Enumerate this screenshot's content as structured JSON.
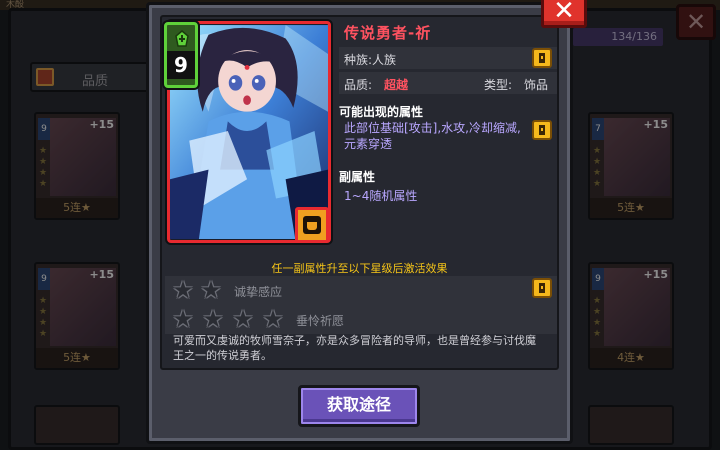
{
  "background": {
    "top_text": "木酘",
    "sort_label": "品质",
    "counter": "134/136",
    "cards": [
      {
        "cost": "9",
        "plus": "+15",
        "footer": "5连★"
      },
      {
        "cost": "7",
        "plus": "+15",
        "footer": "5连★"
      },
      {
        "cost": "9",
        "plus": "+15",
        "footer": "5连★"
      },
      {
        "cost": "9",
        "plus": "+15",
        "footer": "4连★"
      }
    ],
    "close_glyph": "✕"
  },
  "dialog": {
    "close_glyph": "✕",
    "card": {
      "cost": "9",
      "title": "传说勇者-祈",
      "race": "种族:人族",
      "quality_label": "品质:",
      "quality_value": "超越",
      "type_label": "类型:",
      "type_value": "饰品"
    },
    "possible_attributes": {
      "heading": "可能出现的属性",
      "text": "此部位基础[攻击],水攻,冷却缩减,元素穿透"
    },
    "sub_attributes": {
      "heading": "副属性",
      "text": "1~4随机属性"
    },
    "activate_hint": "任一副属性升至以下星级后激活效果",
    "star_effects": [
      {
        "stars": 2,
        "label": "诚挚感应"
      },
      {
        "stars": 4,
        "label": "垂怜祈愿"
      }
    ],
    "description": "可爱而又虔诚的牧师雪奈子，亦是众多冒险者的导师，也是曾经参与讨伐魔王之一的传说勇者。",
    "get_button": "获取途径"
  },
  "colors": {
    "title_red": "#ff5260",
    "attr_purple": "#b9a7ff",
    "hint_yellow": "#f5c518",
    "button_purple": "#6a52b8"
  }
}
